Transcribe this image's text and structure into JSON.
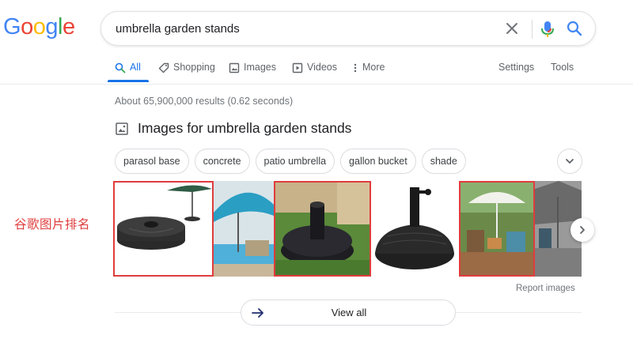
{
  "logo": {
    "letters": [
      "G",
      "o",
      "o",
      "g",
      "l",
      "e"
    ],
    "colors": [
      "#4285f4",
      "#ea4335",
      "#fbbc05",
      "#4285f4",
      "#34a853",
      "#ea4335"
    ]
  },
  "search": {
    "query": "umbrella garden stands",
    "clear_icon": "close-icon",
    "mic_icon": "mic-icon",
    "search_icon": "search-icon"
  },
  "tabs": {
    "all": "All",
    "shopping": "Shopping",
    "images": "Images",
    "videos": "Videos",
    "more": "More",
    "settings": "Settings",
    "tools": "Tools"
  },
  "result_stats": "About 65,900,000 results (0.62 seconds)",
  "images_section": {
    "title": "Images for umbrella garden stands",
    "chips": [
      "parasol base",
      "concrete",
      "patio umbrella",
      "gallon bucket",
      "shade"
    ],
    "thumbnails": [
      {
        "name": "black-round-umbrella-base",
        "highlighted": true
      },
      {
        "name": "teal-patio-umbrella-pool",
        "highlighted": false
      },
      {
        "name": "dark-umbrella-base-on-grass",
        "highlighted": true
      },
      {
        "name": "black-woven-umbrella-base",
        "highlighted": false
      },
      {
        "name": "white-umbrella-deck-chairs",
        "highlighted": true
      },
      {
        "name": "grey-umbrella-patio",
        "highlighted": false
      }
    ],
    "report_link": "Report images",
    "view_all": "View all"
  },
  "annotation": {
    "text": "谷歌图片排名",
    "color": "#e03c3c"
  },
  "colors": {
    "accent": "#1a73e8",
    "muted": "#70757a",
    "highlight_border": "#e03c3c"
  }
}
